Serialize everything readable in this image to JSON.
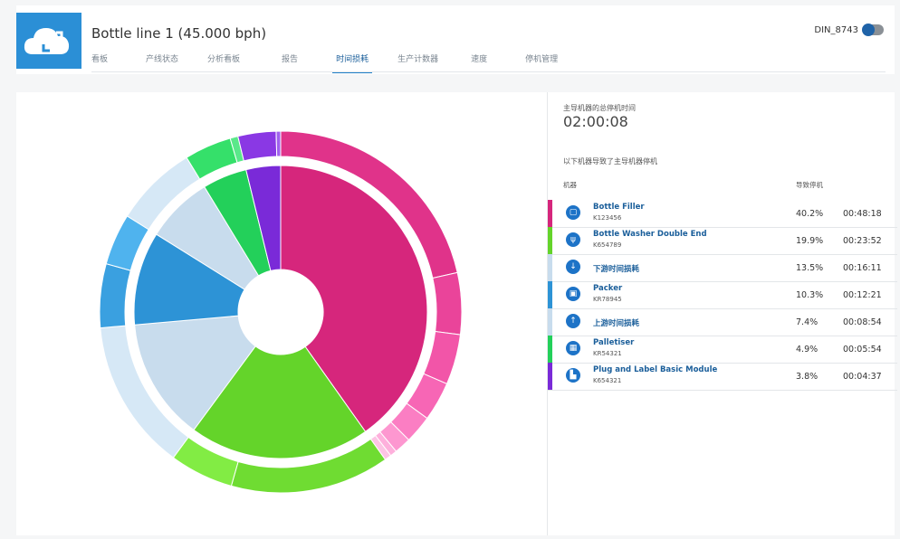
{
  "header": {
    "title": "Bottle line 1 (45.000 bph)",
    "user": "DIN_8743",
    "tabs": [
      "看板",
      "产线状态",
      "分析看板",
      "报告",
      "时间损耗",
      "生产计数器",
      "速度",
      "停机管理"
    ],
    "active_tab": "时间损耗"
  },
  "summary": {
    "total_label": "主导机器的总停机时间",
    "total_value": "02:00:08",
    "subtitle": "以下机器导致了主导机器停机",
    "col_machine": "机器",
    "col_downtime": "导致停机"
  },
  "machines": [
    {
      "name": "Bottle Filler",
      "code": "K123456",
      "pct": "40.2%",
      "time": "00:48:18",
      "color": "#d6267c",
      "icon": "filler-icon"
    },
    {
      "name": "Bottle Washer Double End",
      "code": "K654789",
      "pct": "19.9%",
      "time": "00:23:52",
      "color": "#64d42a",
      "icon": "washer-icon"
    },
    {
      "name": "下游时间损耗",
      "code": "",
      "pct": "13.5%",
      "time": "00:16:11",
      "color": "#c8dced",
      "icon": "arrow-down-icon"
    },
    {
      "name": "Packer",
      "code": "KR78945",
      "pct": "10.3%",
      "time": "00:12:21",
      "color": "#2d93d6",
      "icon": "packer-icon"
    },
    {
      "name": "上游时间损耗",
      "code": "",
      "pct": "7.4%",
      "time": "00:08:54",
      "color": "#c8dced",
      "icon": "arrow-up-icon"
    },
    {
      "name": "Palletiser",
      "code": "KR54321",
      "pct": "4.9%",
      "time": "00:05:54",
      "color": "#23d05a",
      "icon": "palletiser-icon"
    },
    {
      "name": "Plug and Label Basic Module",
      "code": "K654321",
      "pct": "3.8%",
      "time": "00:04:37",
      "color": "#7a2ad8",
      "icon": "label-module-icon"
    }
  ],
  "chart_data": {
    "type": "pie",
    "subtype": "sunburst",
    "inner": [
      {
        "label": "Bottle Filler",
        "value": 40.2,
        "color": "#d6267c"
      },
      {
        "label": "Bottle Washer Double End",
        "value": 19.9,
        "color": "#64d42a"
      },
      {
        "label": "下游时间损耗",
        "value": 13.5,
        "color": "#c8dced"
      },
      {
        "label": "Packer",
        "value": 10.3,
        "color": "#2d93d6"
      },
      {
        "label": "上游时间损耗",
        "value": 7.4,
        "color": "#c8dced"
      },
      {
        "label": "Palletiser",
        "value": 4.9,
        "color": "#23d05a"
      },
      {
        "label": "Plug and Label Basic Module",
        "value": 3.8,
        "color": "#7a2ad8"
      }
    ],
    "outer": [
      {
        "parent": 0,
        "value": 21.5,
        "color": "#e0338a"
      },
      {
        "parent": 0,
        "value": 5.5,
        "color": "#ea449a"
      },
      {
        "parent": 0,
        "value": 4.5,
        "color": "#f255a8"
      },
      {
        "parent": 0,
        "value": 3.5,
        "color": "#f766b5"
      },
      {
        "parent": 0,
        "value": 2.5,
        "color": "#fb7ec3"
      },
      {
        "parent": 0,
        "value": 1.5,
        "color": "#fd97d0"
      },
      {
        "parent": 0,
        "value": 0.6,
        "color": "#feb0dc"
      },
      {
        "parent": 0,
        "value": 0.6,
        "color": "#fcc4e4"
      },
      {
        "parent": 1,
        "value": 14.2,
        "color": "#6fdc32"
      },
      {
        "parent": 1,
        "value": 5.7,
        "color": "#82ec44"
      },
      {
        "parent": 2,
        "value": 13.5,
        "color": "#d6e8f6"
      },
      {
        "parent": 3,
        "value": 5.7,
        "color": "#3aa0e0"
      },
      {
        "parent": 3,
        "value": 4.6,
        "color": "#4fb3ee"
      },
      {
        "parent": 4,
        "value": 7.4,
        "color": "#d6e8f6"
      },
      {
        "parent": 5,
        "value": 4.2,
        "color": "#35e06a"
      },
      {
        "parent": 5,
        "value": 0.7,
        "color": "#5ae88a"
      },
      {
        "parent": 6,
        "value": 3.4,
        "color": "#8a38e4"
      },
      {
        "parent": 6,
        "value": 0.4,
        "color": "#a060ee"
      }
    ]
  }
}
